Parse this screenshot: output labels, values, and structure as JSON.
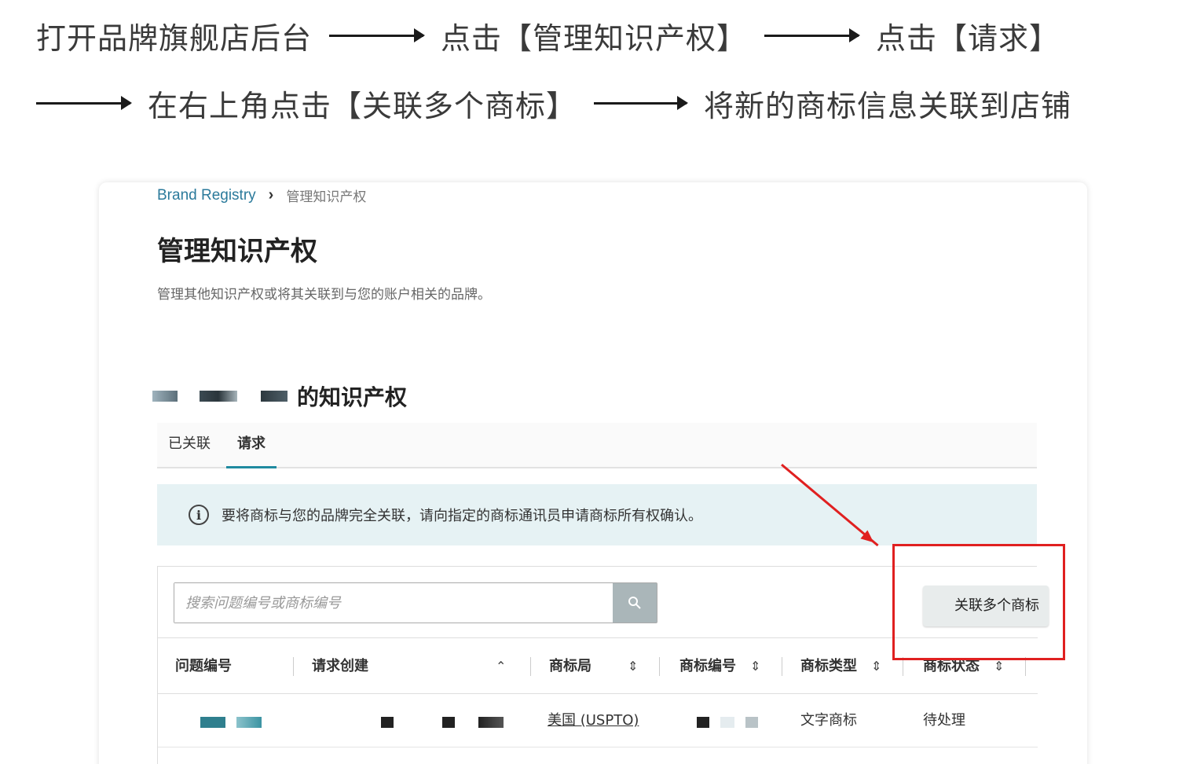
{
  "instructions": {
    "step1": "打开品牌旗舰店后台",
    "step2": "点击【管理知识产权】",
    "step3": "点击【请求】",
    "step4": "在右上角点击【关联多个商标】",
    "step5": "将新的商标信息关联到店铺"
  },
  "breadcrumb": {
    "root": "Brand Registry",
    "separator": "›",
    "current": "管理知识产权"
  },
  "page": {
    "title": "管理知识产权",
    "description": "管理其他知识产权或将其关联到与您的账户相关的品牌。"
  },
  "ip_section": {
    "title_suffix": "的知识产权"
  },
  "tabs": [
    {
      "label": "已关联"
    },
    {
      "label": "请求"
    }
  ],
  "info_banner": {
    "icon": "i",
    "text": "要将商标与您的品牌完全关联，请向指定的商标通讯员申请商标所有权确认。"
  },
  "search": {
    "placeholder": "搜索问题编号或商标编号"
  },
  "link_button": {
    "label": "关联多个商标"
  },
  "table": {
    "columns": [
      {
        "label": "问题编号"
      },
      {
        "label": "请求创建"
      },
      {
        "label": "商标局"
      },
      {
        "label": "商标编号"
      },
      {
        "label": "商标类型"
      },
      {
        "label": "商标状态"
      }
    ],
    "rows": [
      {
        "office": "美国 (USPTO)",
        "type": "文字商标",
        "status": "待处理"
      }
    ]
  },
  "colors": {
    "accent": "#1f8aa0",
    "link": "#2b7a9b",
    "annotation": "#e02020",
    "banner": "#e6f2f4"
  }
}
